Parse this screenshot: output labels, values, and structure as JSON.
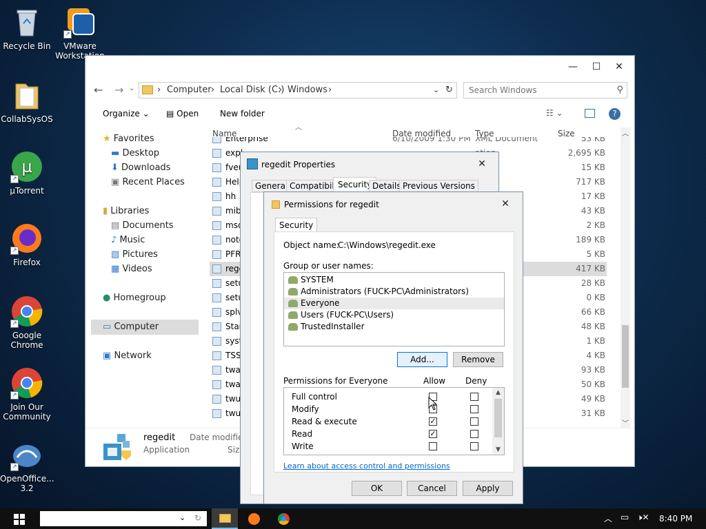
{
  "desktop": {
    "icons": [
      {
        "label": "Recycle Bin"
      },
      {
        "label": "VMware Workstation"
      },
      {
        "label": "CollabSysOS"
      },
      {
        "label": "µTorrent"
      },
      {
        "label": "Firefox"
      },
      {
        "label": "Google Chrome"
      },
      {
        "label": "Join Our Community"
      },
      {
        "label": "OpenOffice... 3.2"
      }
    ]
  },
  "explorer": {
    "breadcrumb": [
      "Computer",
      "Local Disk (C:)",
      "Windows"
    ],
    "search_placeholder": "Search Windows",
    "toolbar": {
      "organize": "Organize",
      "open": "Open",
      "new_folder": "New folder"
    },
    "nav": {
      "favorites": "Favorites",
      "desktop": "Desktop",
      "downloads": "Downloads",
      "recent": "Recent Places",
      "libraries": "Libraries",
      "documents": "Documents",
      "music": "Music",
      "pictures": "Pictures",
      "videos": "Videos",
      "homegroup": "Homegroup",
      "computer": "Computer",
      "network": "Network"
    },
    "columns": {
      "name": "Name",
      "date": "Date modified",
      "type": "Type",
      "size": "Size"
    },
    "files": [
      {
        "name": "Enterprise",
        "date": "6/10/2009 1:30 PM",
        "type": "XML Document",
        "size": "53 KB"
      },
      {
        "name": "expl",
        "type": "ation",
        "size": "2,695 KB"
      },
      {
        "name": "fveu",
        "type": "ation",
        "size": "15 KB"
      },
      {
        "name": "Help",
        "type": "ation",
        "size": "717 KB"
      },
      {
        "name": "hh",
        "size": "17 KB"
      },
      {
        "name": "mib",
        "size": "43 KB"
      },
      {
        "name": "msd",
        "type": "n sett...",
        "size": "2 KB"
      },
      {
        "name": "note",
        "size": "189 KB"
      },
      {
        "name": "PFR",
        "type": "nt",
        "size": "5 KB"
      },
      {
        "name": "rege",
        "size": "417 KB"
      },
      {
        "name": "setu",
        "size": "28 KB"
      },
      {
        "name": "setu",
        "type": "nt",
        "size": "0 KB"
      },
      {
        "name": "splv",
        "size": "66 KB"
      },
      {
        "name": "Star",
        "type": "ent",
        "size": "48 KB"
      },
      {
        "name": "syst",
        "type": "n sett...",
        "size": "1 KB"
      },
      {
        "name": "TSS",
        "type": "nt",
        "size": "4 KB"
      },
      {
        "name": "twa",
        "type": "extens...",
        "size": "93 KB"
      },
      {
        "name": "twa",
        "type": "extens...",
        "size": "50 KB"
      },
      {
        "name": "twu",
        "size": "49 KB"
      },
      {
        "name": "twu",
        "size": "31 KB"
      }
    ],
    "details": {
      "name": "regedit",
      "type": "Application",
      "date_label": "Date modified",
      "size_label": "Size"
    }
  },
  "props": {
    "title": "regedit Properties",
    "tabs": [
      "General",
      "Compatibility",
      "Security",
      "Details",
      "Previous Versions"
    ]
  },
  "perm": {
    "title": "Permissions for regedit",
    "tab": "Security",
    "object_label": "Object name:",
    "object_value": "C:\\Windows\\regedit.exe",
    "group_label": "Group or user names:",
    "users": [
      "SYSTEM",
      "Administrators (FUCK-PC\\Administrators)",
      "Everyone",
      "Users (FUCK-PC\\Users)",
      "TrustedInstaller"
    ],
    "add": "Add...",
    "remove": "Remove",
    "perms_label": "Permissions for Everyone",
    "allow": "Allow",
    "deny": "Deny",
    "perms": [
      {
        "name": "Full control",
        "allow": false,
        "deny": false
      },
      {
        "name": "Modify",
        "allow": false,
        "deny": false
      },
      {
        "name": "Read & execute",
        "allow": true,
        "deny": false
      },
      {
        "name": "Read",
        "allow": true,
        "deny": false
      },
      {
        "name": "Write",
        "allow": false,
        "deny": false
      }
    ],
    "link": "Learn about access control and permissions",
    "ok": "OK",
    "cancel": "Cancel",
    "apply": "Apply"
  },
  "taskbar": {
    "time": "8:40 PM"
  }
}
